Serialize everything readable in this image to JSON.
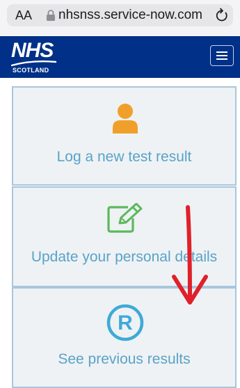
{
  "browser": {
    "text_size_label": "AA",
    "url": "nhsnss.service-now.com"
  },
  "header": {
    "logo_title": "NHS",
    "logo_subtitle": "SCOTLAND",
    "menu_icon": "hamburger-menu-icon"
  },
  "tiles": [
    {
      "label": "Log a new test result",
      "icon": "person-icon",
      "icon_color": "#f0a02a"
    },
    {
      "label": "Update your personal details",
      "icon": "edit-icon",
      "icon_color": "#5cb85c"
    },
    {
      "label": "See previous results",
      "icon": "registered-icon",
      "icon_color": "#3fa9d8"
    }
  ],
  "colors": {
    "header_bg": "#003087",
    "tile_border": "#a9c6dd",
    "tile_bg": "#eef2f4",
    "tile_text": "#5aa2c8",
    "annotation_arrow": "#e0202a"
  }
}
